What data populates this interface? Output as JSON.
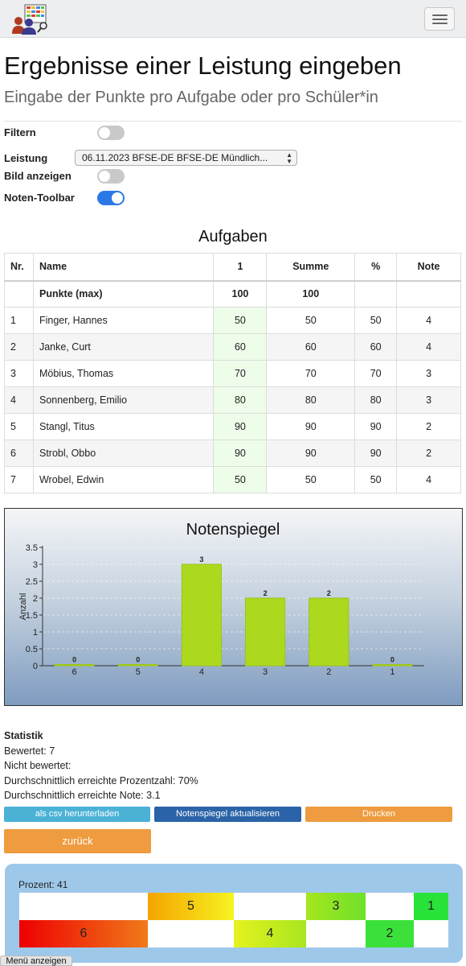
{
  "page": {
    "title": "Ergebnisse einer Leistung eingeben",
    "subtitle": "Eingabe der Punkte pro Aufgabe oder pro Schüler*in"
  },
  "filters": {
    "filtern_label": "Filtern",
    "filtern_on": false,
    "leistung_label": "Leistung",
    "leistung_value": "06.11.2023 BFSE-DE BFSE-DE Mündlich...",
    "bild_label": "Bild anzeigen",
    "bild_on": false,
    "toolbar_label": "Noten-Toolbar",
    "toolbar_on": true
  },
  "table": {
    "title": "Aufgaben",
    "headers": [
      "Nr.",
      "Name",
      "1",
      "Summe",
      "%",
      "Note"
    ],
    "max_row": {
      "label": "Punkte (max)",
      "p1": "100",
      "summe": "100"
    },
    "rows": [
      {
        "nr": "1",
        "name": "Finger, Hannes",
        "p1": "50",
        "summe": "50",
        "pct": "50",
        "note": "4"
      },
      {
        "nr": "2",
        "name": "Janke, Curt",
        "p1": "60",
        "summe": "60",
        "pct": "60",
        "note": "4"
      },
      {
        "nr": "3",
        "name": "Möbius, Thomas",
        "p1": "70",
        "summe": "70",
        "pct": "70",
        "note": "3"
      },
      {
        "nr": "4",
        "name": "Sonnenberg, Emilio",
        "p1": "80",
        "summe": "80",
        "pct": "80",
        "note": "3"
      },
      {
        "nr": "5",
        "name": "Stangl, Titus",
        "p1": "90",
        "summe": "90",
        "pct": "90",
        "note": "2"
      },
      {
        "nr": "6",
        "name": "Strobl, Obbo",
        "p1": "90",
        "summe": "90",
        "pct": "90",
        "note": "2"
      },
      {
        "nr": "7",
        "name": "Wrobel, Edwin",
        "p1": "50",
        "summe": "50",
        "pct": "50",
        "note": "4"
      }
    ]
  },
  "chart_data": {
    "type": "bar",
    "title": "Notenspiegel",
    "ylabel": "Anzahl",
    "xlabel": "",
    "categories": [
      "6",
      "5",
      "4",
      "3",
      "2",
      "1"
    ],
    "values": [
      0,
      0,
      3,
      2,
      2,
      0
    ],
    "data_labels": [
      "0",
      "0",
      "3",
      "2",
      "2",
      "0"
    ],
    "ylim": [
      0,
      3.5
    ],
    "yticks": [
      "0",
      "0.5",
      "1",
      "1.5",
      "2",
      "2.5",
      "3",
      "3.5"
    ],
    "grid": true,
    "bar_color": "#acd91e"
  },
  "stats": {
    "title": "Statistik",
    "lines": [
      "Bewertet: 7",
      "Nicht bewertet:",
      "Durchschnittlich erreichte Prozentzahl: 70%",
      "Durchschnittlich erreichte Note: 3.1"
    ]
  },
  "buttons": {
    "csv": "als csv herunterladen",
    "update": "Notenspiegel aktualisieren",
    "print": "Drucken",
    "back": "zurück"
  },
  "grade_toolbar": {
    "percent_label": "Prozent: 41",
    "top_row": [
      "5",
      "3",
      "1"
    ],
    "bottom_row": [
      "6",
      "4",
      "2"
    ]
  },
  "menu_button": "Menü anzeigen"
}
